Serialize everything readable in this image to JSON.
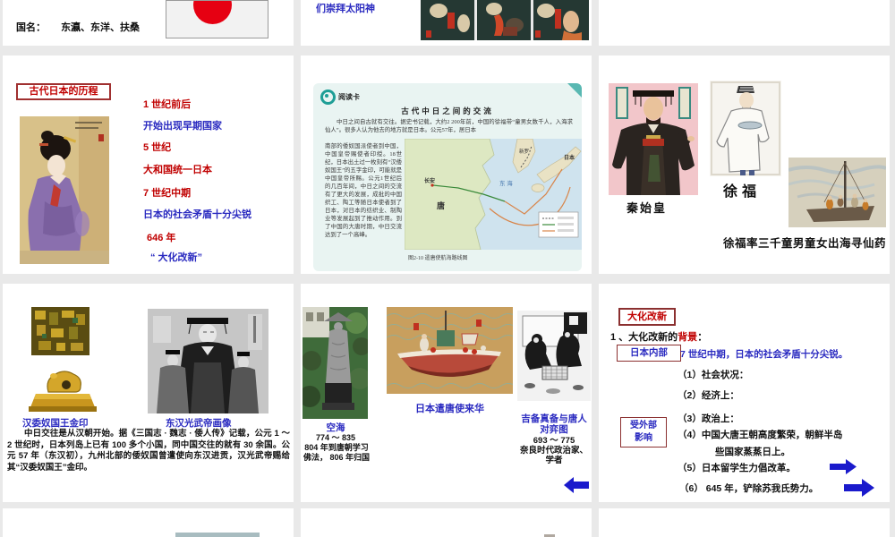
{
  "colors": {
    "background_gray": "#e9e9e9",
    "slide_white": "#ffffff",
    "red_text": "#c00000",
    "blue_text": "#2a2ac0",
    "maroon_box_border": "#8b3030",
    "arrow_blue": "#1a1acc",
    "flag_red": "#e60012",
    "card_teal": "#1f9e96",
    "card_background": "#e9f4f2"
  },
  "row1": {
    "slide_name": {
      "label": "国名：",
      "value": "东瀛、东洋、扶桑"
    },
    "slide_sun": {
      "caption": "们崇拜太阳神"
    }
  },
  "slide_history": {
    "title": "古代日本的历程",
    "timeline": [
      {
        "text": "1 世纪前后"
      },
      {
        "text": "开始出现早期国家"
      },
      {
        "text": "5 世纪"
      },
      {
        "text": "大和国统一日本"
      },
      {
        "text": "7 世纪中期"
      },
      {
        "text": "日本的社会矛盾十分尖锐"
      },
      {
        "text": "646 年"
      },
      {
        "text": "“ 大化改新”"
      }
    ]
  },
  "slide_card": {
    "tag": "阅读卡",
    "title": "古代中日之间的交流",
    "para_top": "中日之间自古就有交往。据史书记载，大约2 200年前，中国的徐福带“童男女数千人，入海求仙人”。很多人认为他去的地方就是日本。公元57年，居日本",
    "para_left": "南部的倭奴国派使者到中国，中国皇帝赐使者印绶。18世纪，日本出土过一枚刻有“汉倭奴国王”的五字金印，可能就是中国皇帝所赐。公元1世纪后的几百年间，中日之间的交流有了更大的发展，成批的中国织工、陶工等随日本使者到了日本，对日本的纺织业、制陶业等发展起到了推动作用。到了中国的大唐时期，中日交流达到了一个高峰。",
    "map": {
      "labels": {
        "changan": "长安",
        "tang": "唐",
        "donghai": "东 海",
        "xinluo": "新罗",
        "riben": "日本"
      },
      "caption": "图2-10 遣唐使航海路线图"
    }
  },
  "slide_xufu": {
    "label_qin": "秦始皇",
    "label_xufu": "徐福",
    "caption": "徐福率三千童男童女出海寻仙药"
  },
  "slide_seal": {
    "label_seal": "汉委奴国王金印",
    "label_emperor": "东汉光武帝画像",
    "para": "中日交往是从汉朝开始。据《三国志 · 魏志 · 倭人传》记载，公元 1 ～ 2 世纪时，日本列岛上已有 100 多个小国，同中国交往的就有 30 余国。公元 57 年（东汉初），九州北部的倭奴国曾遣使向东汉进贡，汉光武帝赐给其“汉委奴国王”金印。"
  },
  "slide_envoys": {
    "kukai_label": "空海",
    "kukai_line1": "774 ～ 835",
    "kukai_line2": "804 年到唐朝学习",
    "kukai_line3": "佛法， 806 年归国",
    "boat_label": "日本遣唐使来华",
    "go_label1": "吉备真备与唐人",
    "go_label2": "对弈图",
    "go_line1": "693 ～ 775",
    "go_line2": "奈良时代政治家、",
    "go_line3": "学者"
  },
  "slide_reform": {
    "box_title": "大化改新",
    "heading_pre": "1 、大化改新的",
    "heading_hl": "背景",
    "heading_post": "：",
    "box_internal": "日本内部",
    "blue_line": "7 世纪中期，日本的社会矛盾十分尖锐。",
    "item1": "（1）社会状况：",
    "item2": "（2）经济上：",
    "item3": "（3）政治上：",
    "item4": "（4）中国大唐王朝高度繁荣，朝鲜半岛",
    "item4b": "些国家蒸蒸日上。",
    "item5": "（5）日本留学生力倡改革。",
    "item6": "（6） 645 年，铲除苏我氏势力。",
    "box_external_1": "受外部",
    "box_external_2": "影响"
  }
}
